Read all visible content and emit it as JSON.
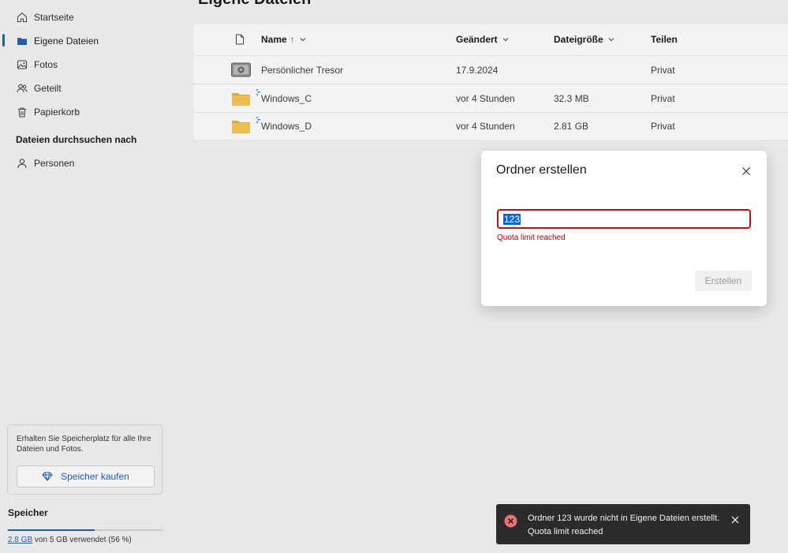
{
  "sidebar": {
    "items": [
      {
        "label": "Startseite",
        "icon": "home-icon"
      },
      {
        "label": "Eigene Dateien",
        "icon": "folder-icon",
        "active": true
      },
      {
        "label": "Fotos",
        "icon": "photos-icon"
      },
      {
        "label": "Geteilt",
        "icon": "people-icon"
      },
      {
        "label": "Papierkorb",
        "icon": "trash-icon"
      }
    ],
    "search_section": {
      "heading": "Dateien durchsuchen nach",
      "items": [
        {
          "label": "Personen",
          "icon": "person-icon"
        }
      ]
    },
    "promo": {
      "text": "Erhalten Sie Speicherplatz für alle Ihre Dateien und Fotos.",
      "button_label": "Speicher kaufen"
    },
    "storage": {
      "title": "Speicher",
      "used": "2.8 GB",
      "rest": "von 5 GB verwendet (56 %)",
      "fraction": 0.56
    }
  },
  "main": {
    "title": "Eigene Dateien",
    "columns": {
      "name": "Name",
      "sort_arrow": "↑",
      "modified": "Geändert",
      "size": "Dateigröße",
      "sharing": "Teilen"
    },
    "files": [
      {
        "name": "Persönlicher Tresor",
        "modified": "17.9.2024",
        "size": "",
        "sharing": "Privat",
        "icon": "vault-icon"
      },
      {
        "name": "Windows_C",
        "modified": "vor 4 Stunden",
        "size": "32.3 MB",
        "sharing": "Privat",
        "icon": "folder-icon"
      },
      {
        "name": "Windows_D",
        "modified": "vor 4 Stunden",
        "size": "2.81 GB",
        "sharing": "Privat",
        "icon": "folder-icon"
      }
    ]
  },
  "dialog": {
    "title": "Ordner erstellen",
    "input_value": "123",
    "error": "Quota limit reached",
    "create_label": "Erstellen"
  },
  "toast": {
    "line1": "Ordner 123 wurde nicht in Eigene Dateien erstellt.",
    "line2": "Quota limit reached"
  },
  "colors": {
    "accent": "#1f5fa8",
    "error": "#a80000",
    "folder": "#e8b84a",
    "toast_bg": "#2b2b2b"
  }
}
